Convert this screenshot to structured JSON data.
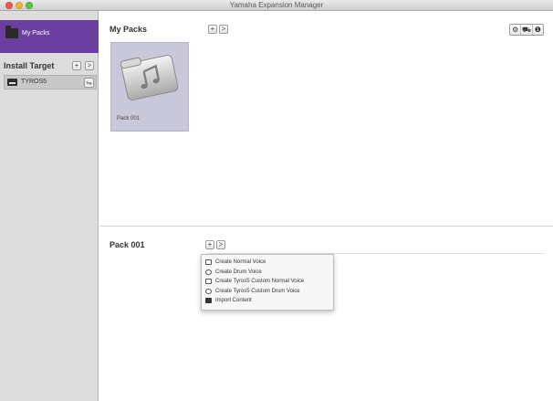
{
  "window": {
    "title": "Yamaha Expansion Manager"
  },
  "sidebar": {
    "my_packs_label": "My Packs",
    "install_target_title": "Install Target",
    "add_glyph": "+",
    "next_glyph": ">",
    "device_label": "TYROS5",
    "usb_glyph": "⇋",
    "selected_color": "#6b3fa0"
  },
  "upper": {
    "title": "My Packs",
    "add_glyph": "+",
    "next_glyph": ">",
    "settings_glyph": "⚙",
    "cart_glyph": "⛟",
    "info_glyph": "❶",
    "packs": [
      {
        "label": "Pack 001",
        "icon": "music-folder-icon"
      }
    ]
  },
  "lower": {
    "title": "Pack 001",
    "add_glyph": "+",
    "next_glyph": ">",
    "menu": [
      {
        "label": "Create Normal Voice",
        "icon": "voice-icon"
      },
      {
        "label": "Create Drum Voice",
        "icon": "drum-icon"
      },
      {
        "label": "Create Tyros5 Custom Normal Voice",
        "icon": "voice-icon"
      },
      {
        "label": "Create Tyros5 Custom Drum Voice",
        "icon": "drum-icon"
      },
      {
        "label": "Import Content",
        "icon": "import-icon"
      }
    ]
  }
}
